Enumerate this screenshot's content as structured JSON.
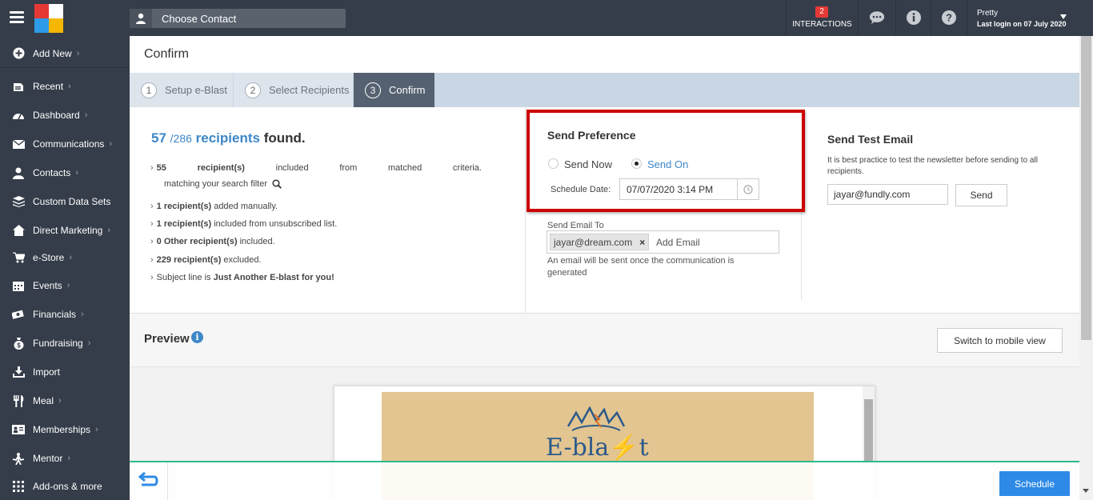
{
  "topbar": {
    "contact_placeholder": "Choose Contact",
    "interactions_count": "2",
    "interactions_label": "INTERACTIONS",
    "user_name": "Pretty",
    "last_login": "Last login on 07 July 2020"
  },
  "sidebar": {
    "items": [
      {
        "label": "Add New",
        "icon": "plus-circle-icon"
      },
      {
        "label": "Recent",
        "icon": "recent-icon"
      },
      {
        "label": "Dashboard",
        "icon": "dashboard-icon"
      },
      {
        "label": "Communications",
        "icon": "envelope-icon"
      },
      {
        "label": "Contacts",
        "icon": "user-icon"
      },
      {
        "label": "Custom Data Sets",
        "icon": "database-icon"
      },
      {
        "label": "Direct Marketing",
        "icon": "home-icon"
      },
      {
        "label": "e-Store",
        "icon": "cart-icon"
      },
      {
        "label": "Events",
        "icon": "calendar-icon"
      },
      {
        "label": "Financials",
        "icon": "money-icon"
      },
      {
        "label": "Fundraising",
        "icon": "moneybag-icon"
      },
      {
        "label": "Import",
        "icon": "import-icon"
      },
      {
        "label": "Meal",
        "icon": "meal-icon"
      },
      {
        "label": "Memberships",
        "icon": "id-card-icon"
      },
      {
        "label": "Mentor",
        "icon": "mentor-icon"
      },
      {
        "label": "Add-ons & more",
        "icon": "grid-icon"
      }
    ]
  },
  "page": {
    "title": "Confirm",
    "steps": [
      {
        "num": "1",
        "label": "Setup e-Blast"
      },
      {
        "num": "2",
        "label": "Select Recipients"
      },
      {
        "num": "3",
        "label": "Confirm"
      }
    ]
  },
  "recipients": {
    "count": "57",
    "total": "/286",
    "word": "recipients",
    "found": "found.",
    "line1_num": "55",
    "line1_a": "recipient(s)",
    "line1_b": "included",
    "line1_c": "from",
    "line1_d": "matched",
    "line1_e": "criteria.",
    "line1_cont": "matching your search filter",
    "line2_bold": "1 recipient(s)",
    "line2_rest": " added manually.",
    "line3_bold": "1 recipient(s)",
    "line3_rest": " included from unsubscribed list.",
    "line4_bold": "0 Other recipient(s)",
    "line4_rest": " included.",
    "line5_bold": "229 recipient(s)",
    "line5_rest": " excluded.",
    "line6_pre": "Subject line is ",
    "line6_bold": "Just Another E-blast for you!"
  },
  "send_preference": {
    "title": "Send Preference",
    "option_now": "Send Now",
    "option_on": "Send On",
    "schedule_label": "Schedule Date:",
    "schedule_value": "07/07/2020 3:14 PM",
    "send_to_label": "Send Email To",
    "chip_email": "jayar@dream.com",
    "add_email_placeholder": "Add Email",
    "note": "An email will be sent once the communication is generated"
  },
  "test_email": {
    "title": "Send Test Email",
    "description": "It is best practice to test the newsletter before sending to all recipients.",
    "email_value": "jayar@fundly.com",
    "send_label": "Send"
  },
  "preview": {
    "title": "Preview",
    "mobile_button": "Switch to mobile view",
    "banner_text": "E-bla⚡t"
  },
  "footer": {
    "schedule_label": "Schedule"
  },
  "colors": {
    "sidebar_bg": "#353d4a",
    "accent_blue": "#3d87c8",
    "highlight_red": "#cc0000",
    "footer_line": "#2cba8f",
    "schedule_btn": "#2e8ae6"
  }
}
